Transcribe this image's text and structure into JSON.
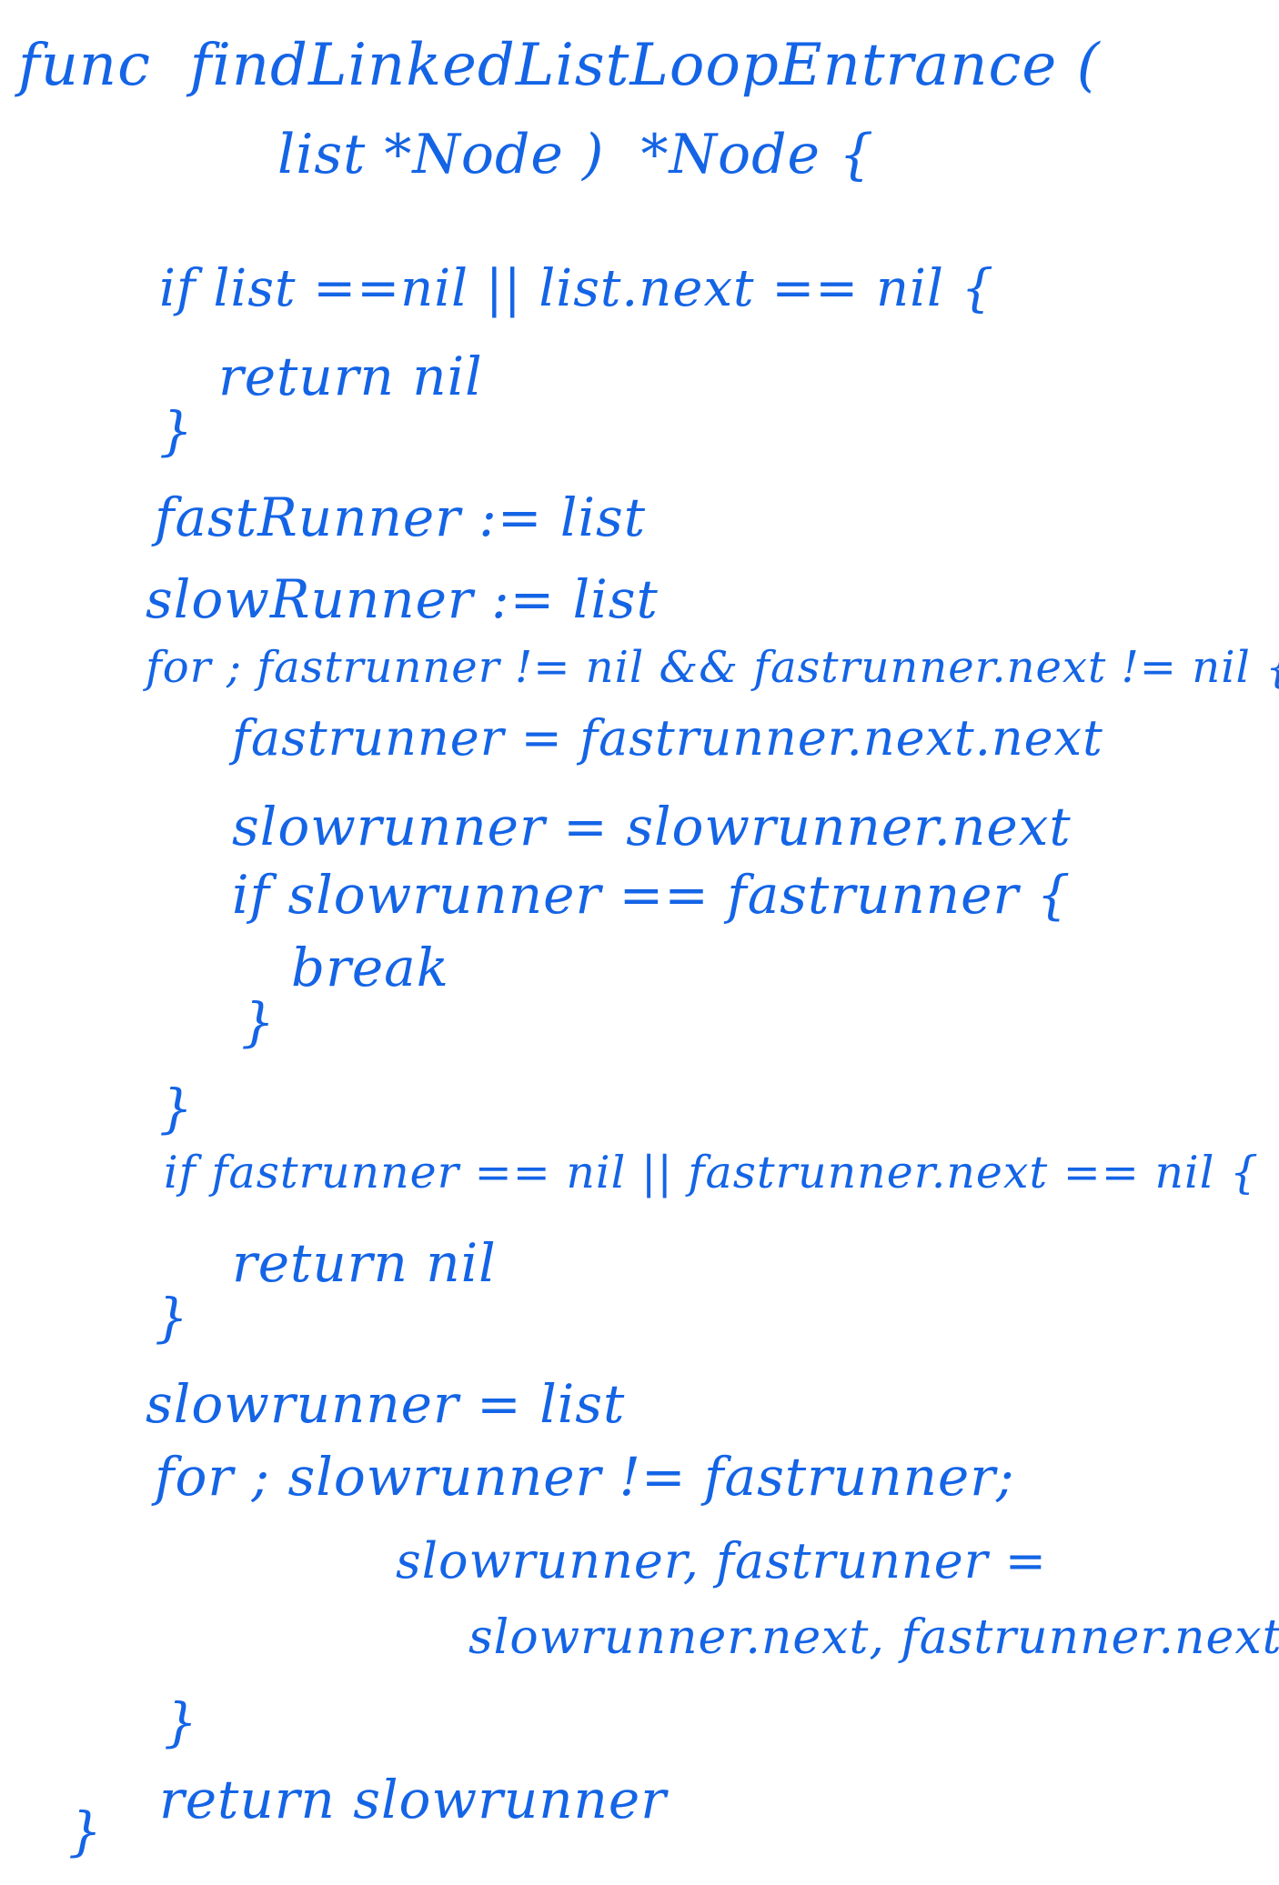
{
  "ink_color": "#1464e6",
  "background_color": "#ffffff",
  "lines": [
    "func  findLinkedListLoopEntrance (",
    "list *Node )  *Node {",
    "if list ==nil || list.next == nil {",
    "return nil",
    "}",
    "fastRunner := list",
    "slowRunner := list",
    "for ; fastrunner != nil && fastrunner.next != nil {",
    "fastrunner = fastrunner.next.next",
    "slowrunner = slowrunner.next",
    "if slowrunner == fastrunner {",
    "break",
    "}",
    "}",
    "if fastrunner == nil || fastrunner.next == nil {",
    "return nil",
    "}",
    "slowrunner = list",
    "for ; slowrunner != fastrunner;",
    "slowrunner, fastrunner =",
    "slowrunner.next, fastrunner.next {",
    "}",
    "return slowrunner",
    "}"
  ]
}
